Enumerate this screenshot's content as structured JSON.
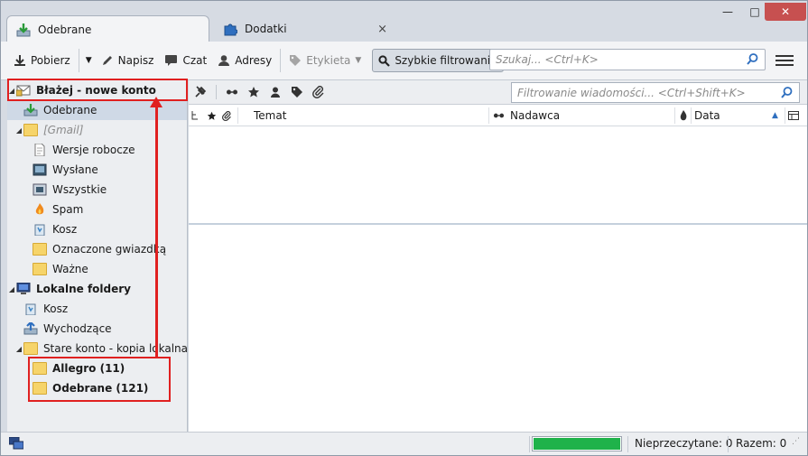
{
  "tabs": [
    {
      "label": "Odebrane",
      "icon": "inbox-download-icon"
    },
    {
      "label": "Dodatki",
      "icon": "puzzle-icon",
      "close": "×"
    }
  ],
  "window_controls": {
    "minimize": "—",
    "maximize": "□",
    "close": "✕"
  },
  "toolbar": {
    "get_label": "Pobierz",
    "write_label": "Napisz",
    "chat_label": "Czat",
    "addresses_label": "Adresy",
    "tag_label": "Etykieta",
    "quickfilter_label": "Szybkie filtrowanie",
    "search_placeholder": "Szukaj... <Ctrl+K>"
  },
  "folders": {
    "account": "Błażej - nowe konto",
    "inbox": "Odebrane",
    "gmail": "[Gmail]",
    "drafts": "Wersje robocze",
    "sent": "Wysłane",
    "all": "Wszystkie",
    "spam": "Spam",
    "trash": "Kosz",
    "starred": "Oznaczone gwiazdką",
    "important": "Ważne",
    "local": "Lokalne foldery",
    "local_trash": "Kosz",
    "outbox": "Wychodzące",
    "old_account": "Stare konto - kopia lokalna",
    "allegro": "Allegro (11)",
    "old_inbox": "Odebrane (121)"
  },
  "quickfilter": {
    "filter_placeholder": "Filtrowanie wiadomości... <Ctrl+Shift+K>"
  },
  "columns": {
    "subject": "Temat",
    "sender": "Nadawca",
    "date": "Data"
  },
  "status": {
    "progress_percent": 100,
    "unread": "Nieprzeczytane: 0",
    "total": "Razem: 0"
  },
  "colors": {
    "progress": "#1fb24a",
    "annotation": "#e02020"
  }
}
